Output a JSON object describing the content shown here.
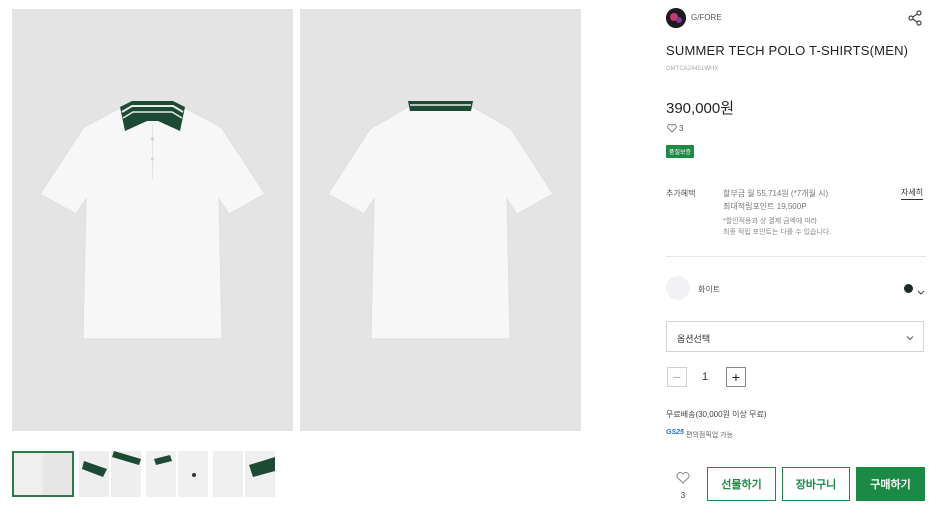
{
  "product": {
    "brand": "G/FORE",
    "name": "SUMMER TECH POLO T-SHIRTS(MEN)",
    "code": "GMTCA24451WHX",
    "price": "390,000원",
    "likes_inline": "3",
    "badge": "품질보증"
  },
  "benefits": {
    "label": "추가혜택",
    "line1": "할부금 월 55,714원 (*7개월 시)",
    "line2": "최대적립포인트 19,500P",
    "note1": "*할인적용과 상 결제 금액에 따라",
    "note2": "최종 적립 포인트는 다를 수 있습니다.",
    "detail_link": "자세히"
  },
  "color": {
    "name": "화이트",
    "swatch_hex": "#f2f2f5",
    "dot_hex": "#1b2b22"
  },
  "option": {
    "placeholder": "옵션선택"
  },
  "quantity": {
    "minus": "−",
    "value": "1",
    "plus": "+"
  },
  "shipping": {
    "text": "무료배송(30,000원 이상 무료)",
    "store_logo": "GS25",
    "store_text": "편의점픽업 가능"
  },
  "actions": {
    "like_count": "3",
    "gift": "선물하기",
    "cart": "장바구니",
    "buy": "구매하기"
  },
  "colors": {
    "accent": "#1f8a46",
    "collar": "#1c4a34"
  }
}
